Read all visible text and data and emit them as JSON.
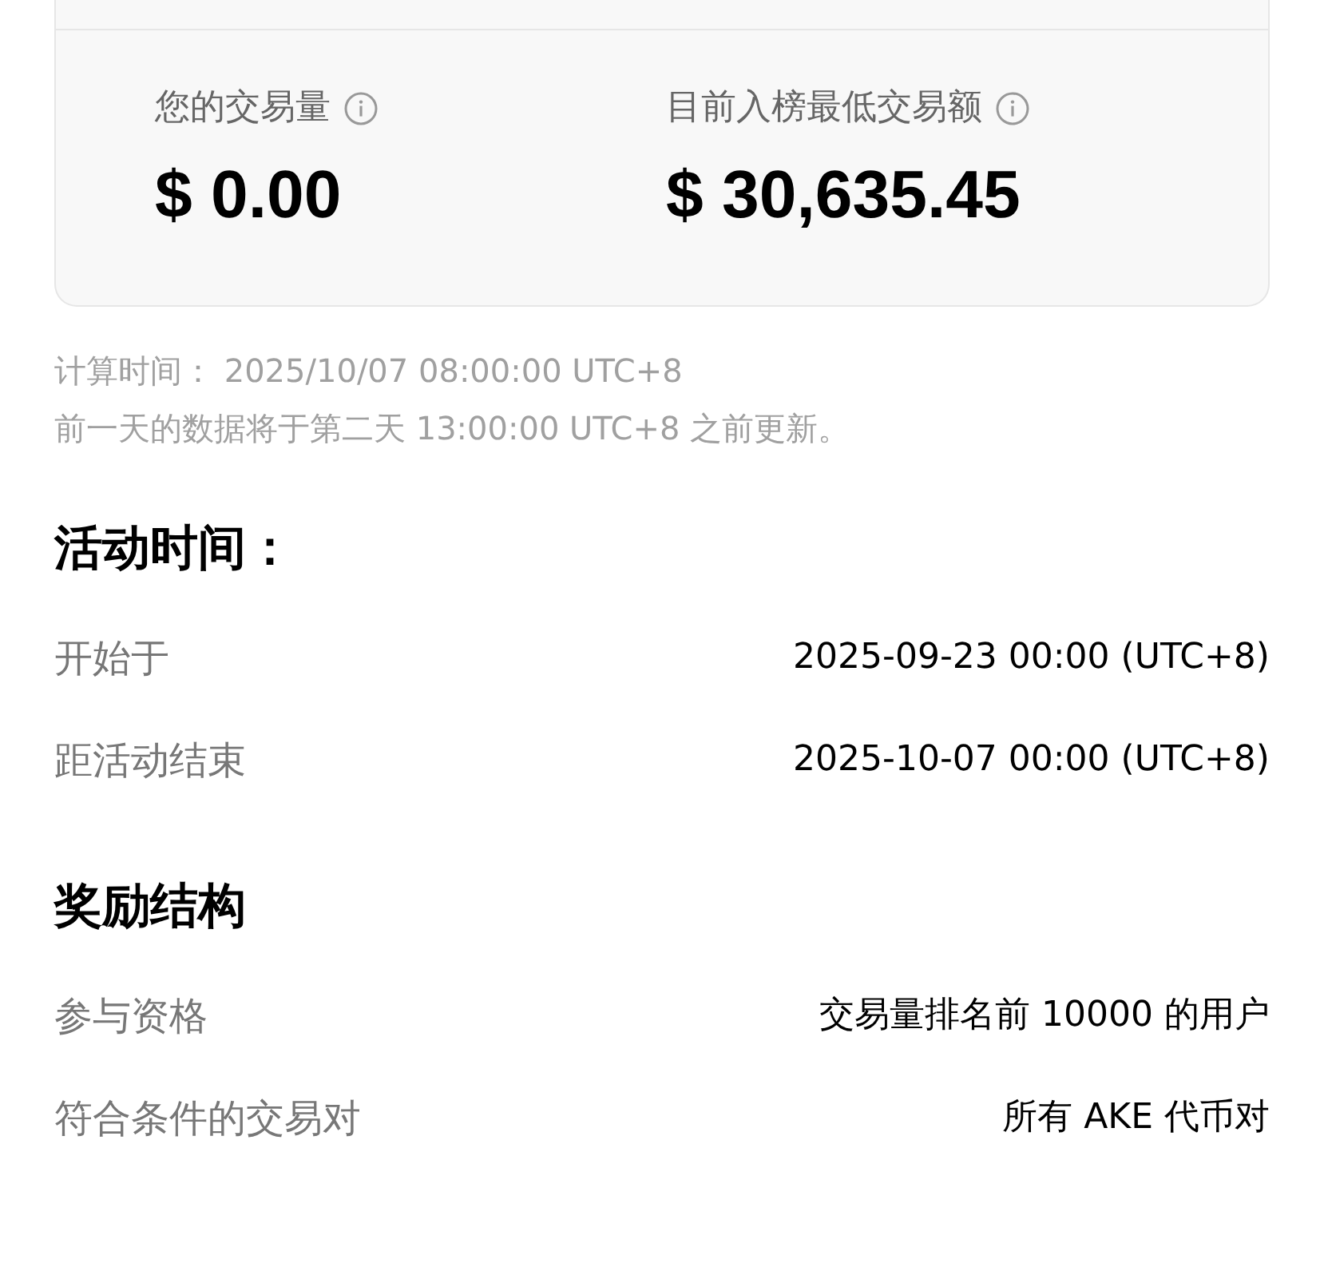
{
  "stats": [
    {
      "label": "您的交易量",
      "value": "$ 0.00"
    },
    {
      "label": "目前入榜最低交易额",
      "value": "$ 30,635.45"
    }
  ],
  "notes": [
    "计算时间： 2025/10/07 08:00:00 UTC+8",
    "前一天的数据将于第二天 13:00:00 UTC+8 之前更新。"
  ],
  "sections": [
    {
      "title": "活动时间：",
      "rows": [
        {
          "label": "开始于",
          "value": "2025-09-23 00:00 (UTC+8)"
        },
        {
          "label": "距活动结束",
          "value": "2025-10-07 00:00 (UTC+8)"
        }
      ]
    },
    {
      "title": "奖励结构",
      "rows": [
        {
          "label": "参与资格",
          "value": "交易量排名前 10000 的用户"
        },
        {
          "label": "符合条件的交易对",
          "value": "所有 AKE 代币对"
        }
      ]
    }
  ]
}
